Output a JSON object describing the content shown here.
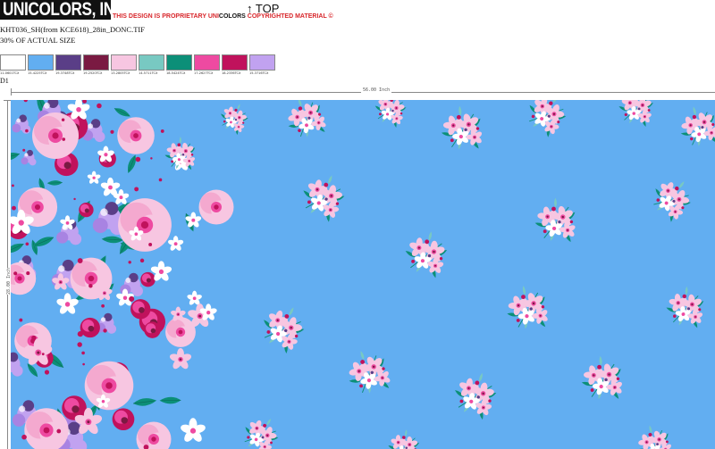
{
  "header": {
    "logo": "UNICOLORS, INC.",
    "notice_prefix": "THIS DESIGN IS PROPRIETARY ",
    "notice_brand_uni": "UNI",
    "notice_brand_rest": "COLORS",
    "notice_suffix": " COPYRIGHTED MATERIAL ©",
    "top_label": "↑ TOP"
  },
  "file": {
    "name": "KHT036_SH(from KCE618)_28in_DONC.TIF",
    "scale": "30% OF ACTUAL SIZE"
  },
  "palette": [
    {
      "code": "11-0601TCX",
      "color": "#ffffff"
    },
    {
      "code": "15-4225TCX",
      "color": "#62aef1"
    },
    {
      "code": "19-3748TCX",
      "color": "#5a3e87"
    },
    {
      "code": "19-2520TCX",
      "color": "#7a1a42"
    },
    {
      "code": "13-2805TCX",
      "color": "#f7c6e1"
    },
    {
      "code": "14-5711TCX",
      "color": "#78c9c2"
    },
    {
      "code": "18-5424TCX",
      "color": "#0c8f78"
    },
    {
      "code": "17-2627TCX",
      "color": "#ee4aa1"
    },
    {
      "code": "18-2336TCX",
      "color": "#c0125c"
    },
    {
      "code": "15-3716TCX",
      "color": "#c1a2f0"
    }
  ],
  "colorway": "D1",
  "ruler": {
    "width_label": "56.00 Inch",
    "height_label": "28.00 Inch"
  },
  "artwork": {
    "ground_color": "#62aef1"
  }
}
